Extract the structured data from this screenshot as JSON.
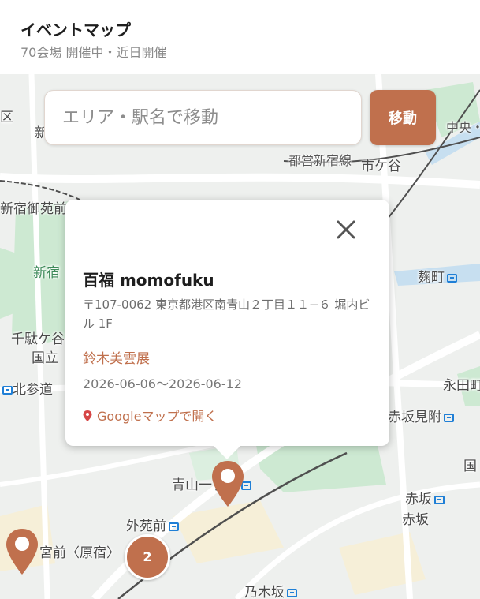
{
  "header": {
    "title": "イベントマップ",
    "subtitle": "70会場 開催中・近日開催"
  },
  "search": {
    "placeholder": "エリア・駅名で移動",
    "value": "",
    "button_label": "移動"
  },
  "popup": {
    "venue_name": "百福 momofuku",
    "address": "〒107-0062 東京都港区南青山２丁目１１−６ 堀内ビル 1F",
    "event_title": "鈴木美雲展",
    "dates": "2026-06-06〜2026-06-12",
    "map_link_label": "Googleマップで開く",
    "close_icon": "close-icon"
  },
  "cluster": {
    "count": "2"
  },
  "map_labels": {
    "ichigaya": "市ケ谷",
    "shinjuku_gyoenmae": "新宿御苑前",
    "shinjuku_green": "新宿",
    "kojimachi": "麹町",
    "sendagaya": "千駄ケ谷",
    "kokuritsu": "国立",
    "kitasando": "北参道",
    "nagatacho": "永田町",
    "akasaka_mitsuke": "赤坂見附",
    "aoyama_itchome": "青山一丁目",
    "akasaka": "赤坂",
    "akasaka2": "赤坂",
    "gaienmae": "外苑前",
    "meiji_jingumae": "宮前〈原宿〉",
    "nogizaka": "乃木坂",
    "toei_shinjuku_line": "都営新宿線",
    "jr_chuo": "中央・",
    "kuni": "国",
    "ku": "区",
    "shin": "新"
  },
  "colors": {
    "accent": "#c0704d",
    "park": "#cde9d2",
    "map_bg": "#eef0ee",
    "road": "#ffffff",
    "rail": "#4f4f4f",
    "water": "#b5d6ee"
  }
}
